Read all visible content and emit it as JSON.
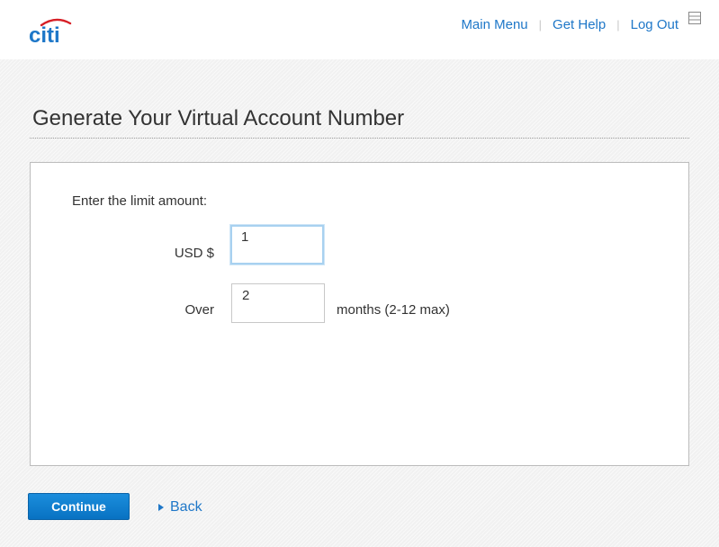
{
  "brand": {
    "logo_text": "citi",
    "accent_color": "#1e77c8",
    "logo_arc_color": "#d71f26"
  },
  "nav": {
    "items": [
      {
        "label": "Main Menu"
      },
      {
        "label": "Get Help"
      },
      {
        "label": "Log Out"
      }
    ],
    "separator": "|",
    "menu_icon": "menu-icon"
  },
  "page": {
    "title": "Generate Your Virtual Account Number"
  },
  "form": {
    "prompt": "Enter the limit amount:",
    "amount": {
      "label": "USD $",
      "value": "1"
    },
    "months": {
      "label": "Over",
      "value": "2",
      "suffix": "months (2-12 max)"
    }
  },
  "actions": {
    "continue_label": "Continue",
    "back_label": "Back",
    "back_icon": "caret-right-icon",
    "button_color": "#0f7fd0"
  }
}
